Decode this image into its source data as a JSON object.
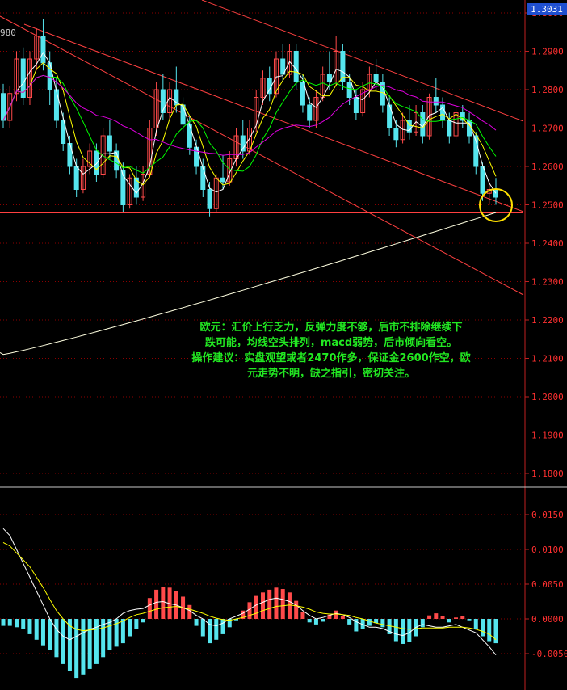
{
  "price_tag": "1.3031",
  "top_left_value": "980",
  "annotation": {
    "lines": [
      "欧元：汇价上行乏力，反弹力度不够，后市不排除继续下",
      "跌可能，均线空头排列，macd弱势，后市倾向看空。",
      "操作建议：实盘观望或者2470作多，保证金2600作空，欧",
      "元走势不明，缺之指引，密切关注。"
    ]
  },
  "colors": {
    "background": "#000000",
    "bull_candle": "#ff4a4a",
    "bear_candle": "#55e5ee",
    "axis": "#c02020",
    "grid": "#8b0000",
    "ma_short": "#ffffff",
    "ma_medium": "#ffff00",
    "ma_long": "#00ff00",
    "ma_purple": "#e000e0",
    "ma_200": "#ffffe0",
    "trend": "#ff4040",
    "highlight_circle": "#ffe000",
    "macd_pos": "#ff4a4a",
    "macd_neg": "#55e5ee"
  },
  "chart_data": {
    "type": "candlestick",
    "price_axis": {
      "range": [
        1.175,
        1.3031
      ],
      "ticks": [
        "1.3000",
        "1.2900",
        "1.2800",
        "1.2700",
        "1.2600",
        "1.2500",
        "1.2400",
        "1.2300",
        "1.2200",
        "1.2100",
        "1.2000",
        "1.1900",
        "1.1800"
      ]
    },
    "macd_axis": {
      "range": [
        -0.0095,
        0.0175
      ],
      "ticks": [
        "0.0150",
        "0.0100",
        "0.0050",
        "0.0000",
        "-0.0050"
      ]
    },
    "candles": [
      [
        1.279,
        1.2815,
        1.27,
        1.272
      ],
      [
        1.272,
        1.281,
        1.27,
        1.279
      ],
      [
        1.279,
        1.29,
        1.277,
        1.288
      ],
      [
        1.288,
        1.291,
        1.276,
        1.278
      ],
      [
        1.278,
        1.29,
        1.276,
        1.288
      ],
      [
        1.288,
        1.296,
        1.285,
        1.294
      ],
      [
        1.294,
        1.2985,
        1.285,
        1.287
      ],
      [
        1.287,
        1.29,
        1.276,
        1.28
      ],
      [
        1.28,
        1.283,
        1.27,
        1.272
      ],
      [
        1.272,
        1.274,
        1.264,
        1.266
      ],
      [
        1.266,
        1.268,
        1.258,
        1.26
      ],
      [
        1.26,
        1.262,
        1.252,
        1.254
      ],
      [
        1.254,
        1.262,
        1.253,
        1.26
      ],
      [
        1.26,
        1.266,
        1.258,
        1.264
      ],
      [
        1.264,
        1.266,
        1.256,
        1.258
      ],
      [
        1.258,
        1.27,
        1.257,
        1.268
      ],
      [
        1.268,
        1.272,
        1.262,
        1.264
      ],
      [
        1.264,
        1.266,
        1.257,
        1.259
      ],
      [
        1.259,
        1.261,
        1.248,
        1.25
      ],
      [
        1.25,
        1.258,
        1.249,
        1.257
      ],
      [
        1.257,
        1.26,
        1.25,
        1.252
      ],
      [
        1.252,
        1.26,
        1.251,
        1.258
      ],
      [
        1.258,
        1.272,
        1.257,
        1.27
      ],
      [
        1.27,
        1.282,
        1.268,
        1.28
      ],
      [
        1.28,
        1.284,
        1.272,
        1.274
      ],
      [
        1.274,
        1.282,
        1.272,
        1.28
      ],
      [
        1.28,
        1.286,
        1.274,
        1.276
      ],
      [
        1.276,
        1.278,
        1.269,
        1.271
      ],
      [
        1.271,
        1.273,
        1.263,
        1.265
      ],
      [
        1.265,
        1.267,
        1.258,
        1.26
      ],
      [
        1.26,
        1.262,
        1.252,
        1.254
      ],
      [
        1.254,
        1.256,
        1.247,
        1.249
      ],
      [
        1.249,
        1.258,
        1.248,
        1.257
      ],
      [
        1.257,
        1.263,
        1.254,
        1.256
      ],
      [
        1.256,
        1.264,
        1.255,
        1.262
      ],
      [
        1.262,
        1.27,
        1.26,
        1.268
      ],
      [
        1.268,
        1.272,
        1.262,
        1.264
      ],
      [
        1.264,
        1.272,
        1.263,
        1.27
      ],
      [
        1.27,
        1.28,
        1.269,
        1.278
      ],
      [
        1.278,
        1.285,
        1.276,
        1.283
      ],
      [
        1.283,
        1.286,
        1.277,
        1.279
      ],
      [
        1.279,
        1.29,
        1.278,
        1.288
      ],
      [
        1.288,
        1.292,
        1.282,
        1.284
      ],
      [
        1.284,
        1.292,
        1.283,
        1.29
      ],
      [
        1.29,
        1.292,
        1.28,
        1.282
      ],
      [
        1.282,
        1.284,
        1.274,
        1.276
      ],
      [
        1.276,
        1.278,
        1.27,
        1.272
      ],
      [
        1.272,
        1.28,
        1.27,
        1.278
      ],
      [
        1.278,
        1.286,
        1.277,
        1.284
      ],
      [
        1.284,
        1.29,
        1.28,
        1.282
      ],
      [
        1.282,
        1.294,
        1.281,
        1.29
      ],
      [
        1.29,
        1.292,
        1.28,
        1.282
      ],
      [
        1.282,
        1.284,
        1.276,
        1.278
      ],
      [
        1.278,
        1.28,
        1.272,
        1.274
      ],
      [
        1.274,
        1.282,
        1.273,
        1.28
      ],
      [
        1.28,
        1.286,
        1.278,
        1.284
      ],
      [
        1.284,
        1.288,
        1.28,
        1.282
      ],
      [
        1.282,
        1.284,
        1.274,
        1.276
      ],
      [
        1.276,
        1.278,
        1.268,
        1.27
      ],
      [
        1.27,
        1.272,
        1.265,
        1.267
      ],
      [
        1.267,
        1.274,
        1.266,
        1.272
      ],
      [
        1.272,
        1.276,
        1.267,
        1.269
      ],
      [
        1.269,
        1.276,
        1.268,
        1.274
      ],
      [
        1.274,
        1.276,
        1.266,
        1.268
      ],
      [
        1.268,
        1.279,
        1.267,
        1.278
      ],
      [
        1.278,
        1.283,
        1.274,
        1.276
      ],
      [
        1.276,
        1.278,
        1.27,
        1.272
      ],
      [
        1.272,
        1.274,
        1.266,
        1.268
      ],
      [
        1.268,
        1.276,
        1.267,
        1.274
      ],
      [
        1.274,
        1.276,
        1.27,
        1.272
      ],
      [
        1.272,
        1.274,
        1.266,
        1.268
      ],
      [
        1.268,
        1.269,
        1.258,
        1.26
      ],
      [
        1.26,
        1.261,
        1.251,
        1.253
      ],
      [
        1.253,
        1.256,
        1.25,
        1.254
      ],
      [
        1.254,
        1.257,
        1.25,
        1.252
      ]
    ],
    "macd": {
      "histogram": [
        -0.001,
        -0.001,
        -0.0012,
        -0.0015,
        -0.0022,
        -0.003,
        -0.0038,
        -0.0045,
        -0.0055,
        -0.0065,
        -0.0075,
        -0.0085,
        -0.008,
        -0.0072,
        -0.0065,
        -0.0055,
        -0.0045,
        -0.004,
        -0.0035,
        -0.0025,
        -0.0015,
        -0.0005,
        0.003,
        0.0042,
        0.0046,
        0.0045,
        0.004,
        0.0032,
        0.002,
        -0.001,
        -0.0025,
        -0.0035,
        -0.003,
        -0.0022,
        -0.0012,
        -0.0002,
        0.0012,
        0.0024,
        0.0033,
        0.0038,
        0.0042,
        0.0045,
        0.0043,
        0.0038,
        0.0026,
        0.001,
        -0.0005,
        -0.0008,
        -0.0004,
        0.0006,
        0.0012,
        0.0004,
        -0.0008,
        -0.0018,
        -0.0015,
        -0.001,
        -0.0006,
        -0.0012,
        -0.0022,
        -0.0032,
        -0.0036,
        -0.0033,
        -0.0025,
        -0.0012,
        0.0005,
        0.0008,
        0.0004,
        -0.0005,
        0.0002,
        0.0004,
        -0.0002,
        -0.0015,
        -0.0025,
        -0.0032,
        -0.0035
      ],
      "dif": [
        0.013,
        0.012,
        0.01,
        0.008,
        0.006,
        0.004,
        0.002,
        0.0,
        -0.0015,
        -0.0025,
        -0.003,
        -0.0025,
        -0.002,
        -0.0015,
        -0.0012,
        -0.0008,
        -0.0005,
        0.0,
        0.0008,
        0.0012,
        0.0014,
        0.0015,
        0.002,
        0.0024,
        0.0025,
        0.0022,
        0.002,
        0.0016,
        0.0012,
        0.0005,
        0.0,
        -0.0008,
        -0.001,
        -0.0006,
        0.0,
        0.0004,
        0.0008,
        0.0014,
        0.002,
        0.0024,
        0.0028,
        0.003,
        0.0028,
        0.0025,
        0.002,
        0.0012,
        0.0005,
        0.0,
        0.0002,
        0.0005,
        0.0008,
        0.0006,
        0.0002,
        -0.0004,
        -0.0008,
        -0.0012,
        -0.0012,
        -0.0014,
        -0.0018,
        -0.0022,
        -0.0024,
        -0.002,
        -0.0012,
        -0.0008,
        -0.001,
        -0.0012,
        -0.0012,
        -0.001,
        -0.0008,
        -0.0012,
        -0.0016,
        -0.002,
        -0.003,
        -0.004,
        -0.0052
      ],
      "dea": [
        0.011,
        0.0105,
        0.0095,
        0.0085,
        0.0075,
        0.006,
        0.0045,
        0.0028,
        0.0012,
        0.0,
        -0.001,
        -0.0015,
        -0.0017,
        -0.0016,
        -0.0015,
        -0.0013,
        -0.001,
        -0.0007,
        -0.0003,
        0.0002,
        0.0006,
        0.0008,
        0.0011,
        0.0014,
        0.0016,
        0.0017,
        0.0018,
        0.0016,
        0.0014,
        0.0011,
        0.0008,
        0.0004,
        0.0001,
        -0.0001,
        -0.0002,
        0.0,
        0.0002,
        0.0005,
        0.0008,
        0.0012,
        0.0015,
        0.0018,
        0.0019,
        0.002,
        0.0019,
        0.0017,
        0.0014,
        0.001,
        0.0008,
        0.0007,
        0.0007,
        0.0006,
        0.0005,
        0.0002,
        0.0,
        -0.0003,
        -0.0006,
        -0.0008,
        -0.001,
        -0.0012,
        -0.0014,
        -0.0015,
        -0.0014,
        -0.0013,
        -0.0013,
        -0.0013,
        -0.0013,
        -0.0012,
        -0.0012,
        -0.0012,
        -0.0013,
        -0.0015,
        -0.0018,
        -0.0022,
        -0.003
      ]
    }
  }
}
